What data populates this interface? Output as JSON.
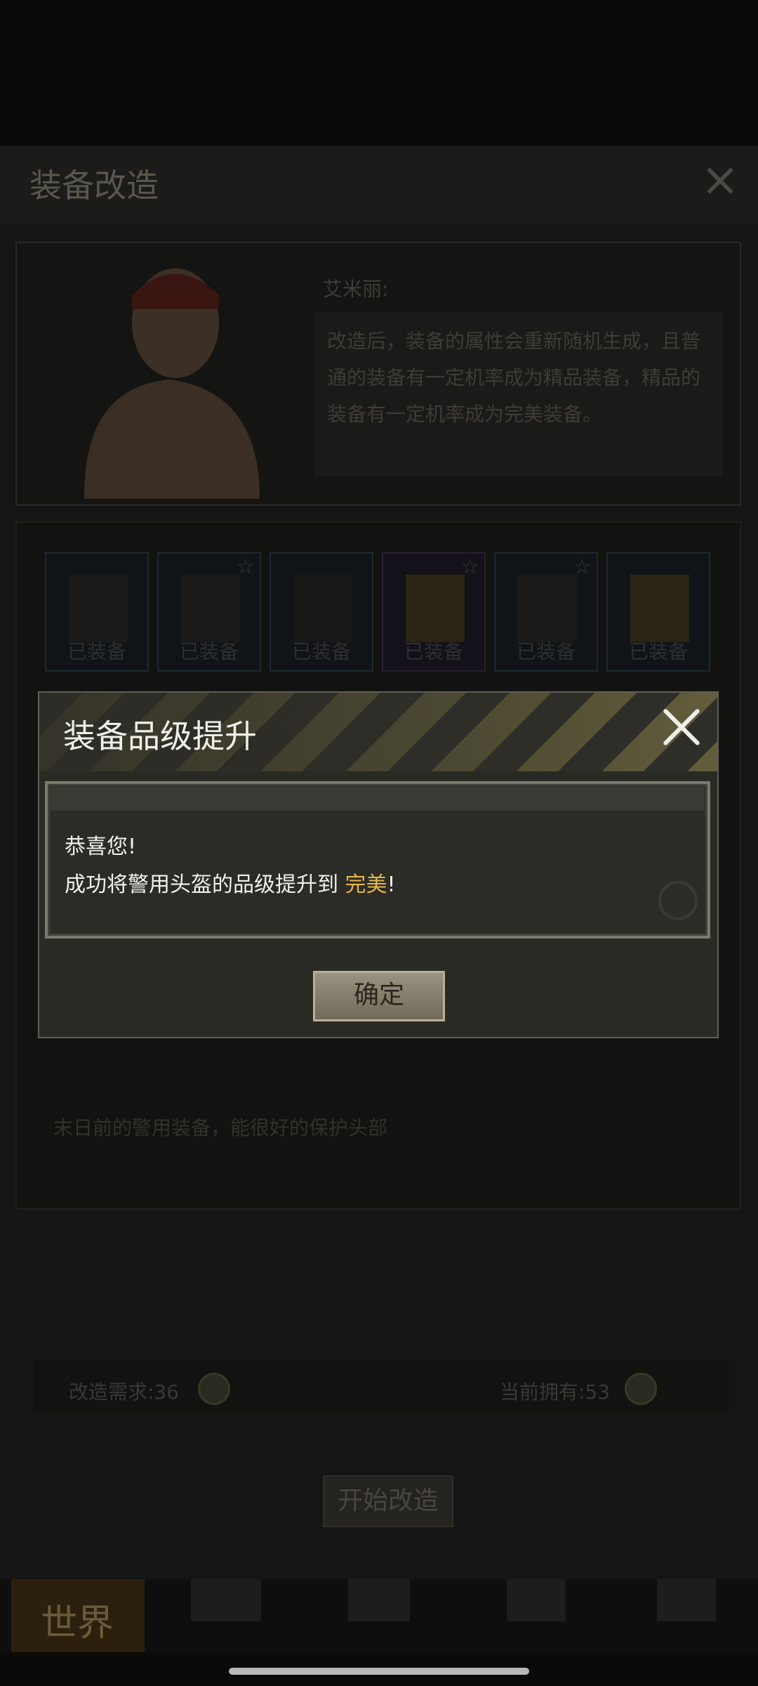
{
  "panel": {
    "title": "装备改造",
    "close_icon": "close-icon",
    "npc": {
      "name": "艾米丽:",
      "speech": "改造后，装备的属性会重新随机生成，且普通的装备有一定机率成为精品装备，精品的装备有一定机率成为完美装备。"
    },
    "equipment": [
      {
        "label": "已装备",
        "icon": "vest-icon",
        "starred": false
      },
      {
        "label": "已装备",
        "icon": "gloves-icon",
        "starred": true
      },
      {
        "label": "已装备",
        "icon": "goggles-icon",
        "starred": false
      },
      {
        "label": "已装备",
        "icon": "boots-icon",
        "starred": true
      },
      {
        "label": "已装备",
        "icon": "shoes-icon",
        "starred": true
      },
      {
        "label": "已装备",
        "icon": "pants-icon",
        "starred": false
      }
    ],
    "item_description": "末日前的警用装备，能很好的保护头部",
    "requirement_label": "改造需求:36",
    "owned_label": "当前拥有:53",
    "start_button": "开始改造"
  },
  "bottom_nav": {
    "world_label": "世界"
  },
  "modal": {
    "title": "装备品级提升",
    "line1": "恭喜您!",
    "line2_prefix": "成功将警用头盔的品级提升到 ",
    "line2_highlight": "完美",
    "line2_suffix": "!",
    "confirm_button": "确定",
    "colors": {
      "highlight": "#e6b84a",
      "header_stripe": "#6f6940"
    }
  }
}
